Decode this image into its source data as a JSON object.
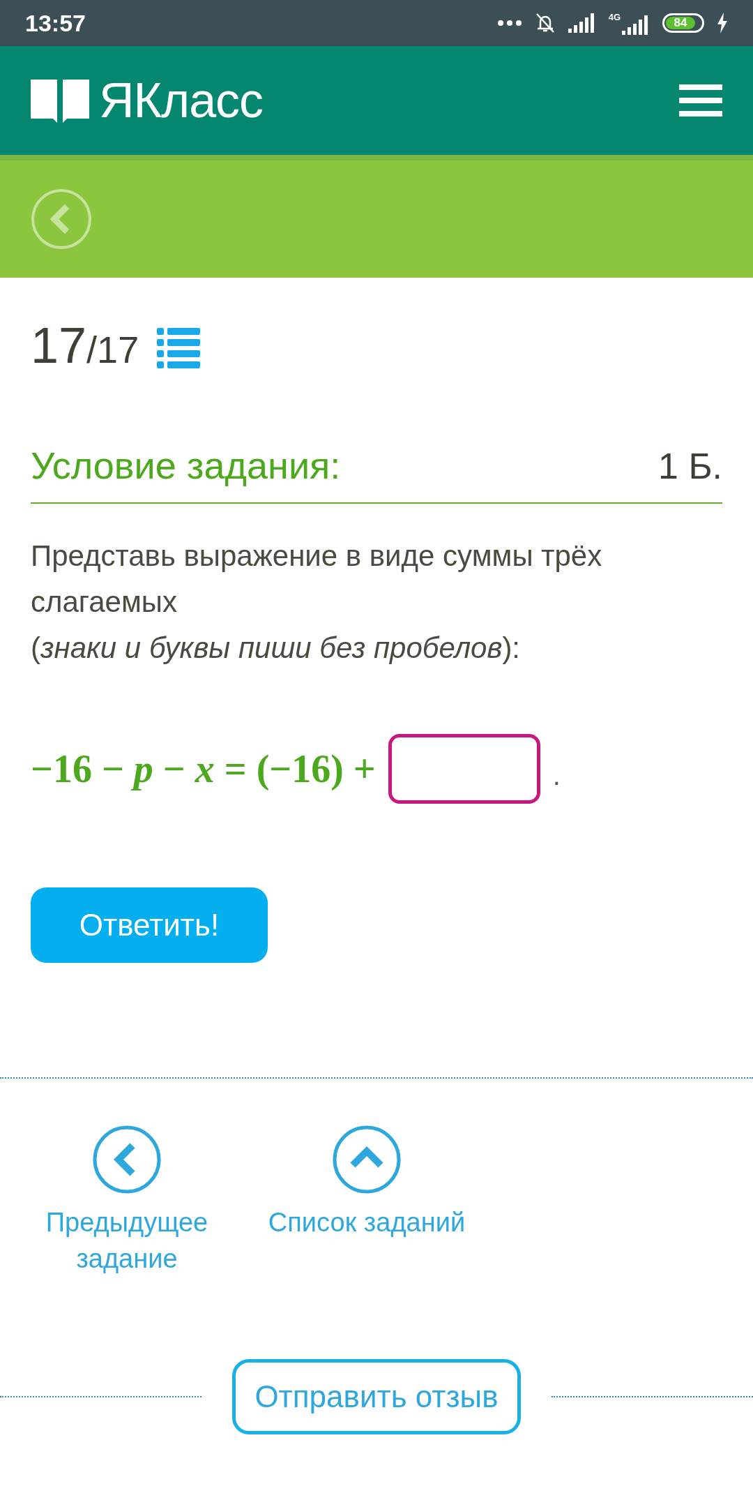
{
  "status_bar": {
    "time": "13:57",
    "network": "4G",
    "battery": "84"
  },
  "header": {
    "logo": "ЯКласс"
  },
  "progress": {
    "current": "17",
    "total": "/17"
  },
  "task": {
    "title": "Условие задания:",
    "points": "1 Б.",
    "text": "Представь выражение в виде суммы трёх слагаемых",
    "hint": "(*знаки и буквы пиши без пробелов*):",
    "equation": "−16 − *p* − *x* = (−16) +",
    "after_field": "."
  },
  "answer_button": "Ответить!",
  "nav": [
    {
      "kind": "prev",
      "label": "Предыдущее задание"
    },
    {
      "kind": "list",
      "label": "Список заданий"
    }
  ],
  "feedback_button": "Отправить отзыв"
}
